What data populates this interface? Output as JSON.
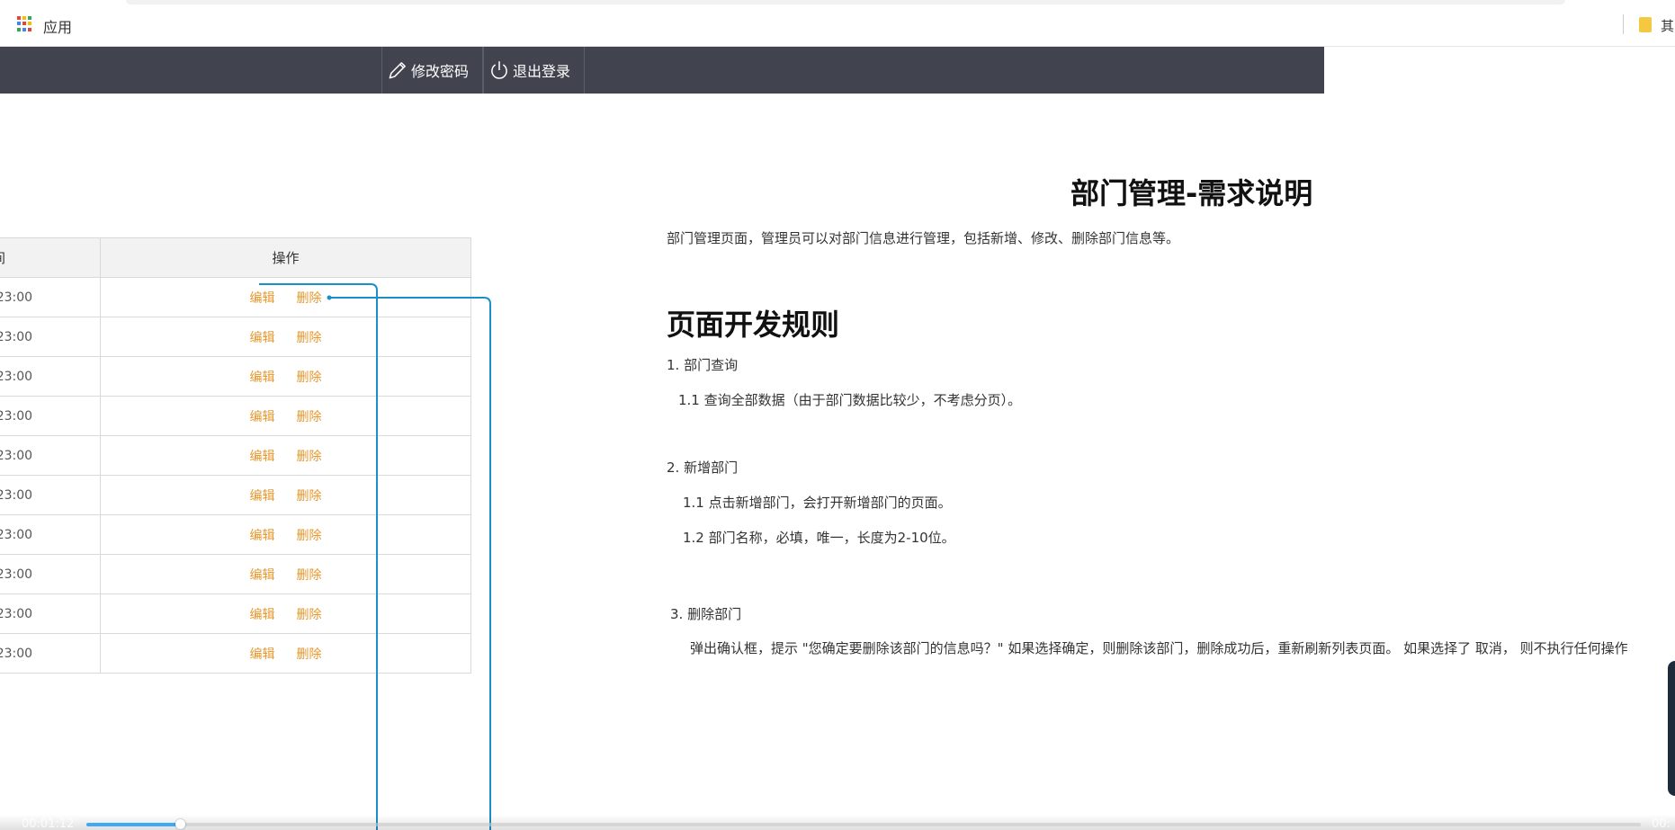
{
  "bookmarks": {
    "apps_label": "应用",
    "other_label": "其",
    "apps_icon_colors": [
      "#ea4335",
      "#fbbc05",
      "#34a853",
      "#4285f4",
      "#ea4335",
      "#fbbc05",
      "#34a853",
      "#4285f4",
      "#ea4335"
    ]
  },
  "header": {
    "change_password": "修改密码",
    "logout": "退出登录",
    "background": "#41444f"
  },
  "table": {
    "headers": [
      "间",
      "操作"
    ],
    "edit_label": "编辑",
    "delete_label": "删除",
    "rows": [
      ":23:00",
      ":23:00",
      ":23:00",
      ":23:00",
      ":23:00",
      ":23:00",
      ":23:00",
      ":23:00",
      ":23:00",
      ":23:00"
    ],
    "action_color": "#e8972b"
  },
  "doc": {
    "title": "部门管理-需求说明",
    "intro": "部门管理页面，管理员可以对部门信息进行管理，包括新增、修改、删除部门信息等。",
    "h2": "页面开发规则",
    "lines": [
      "1. 部门查询",
      "1.1  查询全部数据（由于部门数据比较少，不考虑分页）。",
      "2. 新增部门",
      "1.1 点击新增部门，会打开新增部门的页面。",
      "1.2 部门名称，必填，唯一，长度为2-10位。",
      "3.  删除部门",
      "弹出确认框，提示 \"您确定要删除该部门的信息吗？\"  如果选择确定，则删除该部门，删除成功后，重新刷新列表页面。  如果选择了 取消，  则不执行任何操作"
    ]
  },
  "video": {
    "time_current": "00:01:12",
    "time_total": "00:",
    "progress": 0.06,
    "accent": "#3fa9f5"
  },
  "annotation_color": "#1a8fc9"
}
